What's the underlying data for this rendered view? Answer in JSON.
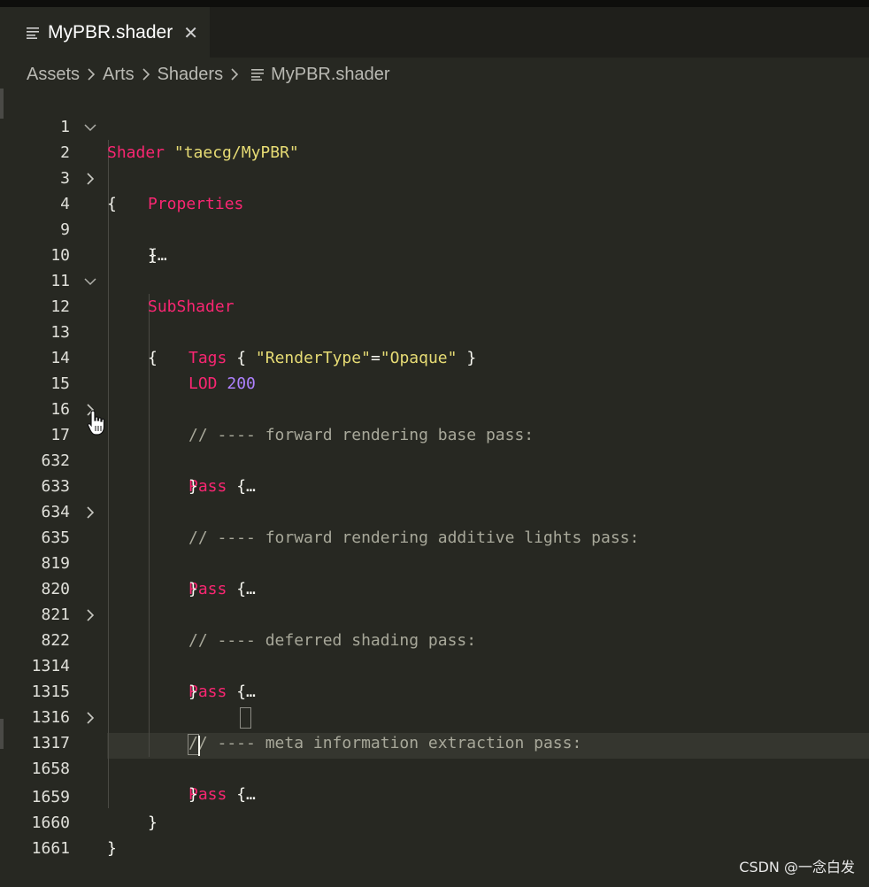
{
  "tab": {
    "title": "MyPBR.shader",
    "close_glyph": "✕"
  },
  "breadcrumb": {
    "items": [
      "Assets",
      "Arts",
      "Shaders"
    ],
    "file": "MyPBR.shader"
  },
  "editor": {
    "lines": [
      {
        "num": "1",
        "fold": ""
      },
      {
        "num": "2",
        "fold": "expanded"
      },
      {
        "num": "3",
        "fold": ""
      },
      {
        "num": "4",
        "fold": "collapsed"
      },
      {
        "num": "9",
        "fold": ""
      },
      {
        "num": "10",
        "fold": ""
      },
      {
        "num": "11",
        "fold": ""
      },
      {
        "num": "12",
        "fold": "expanded"
      },
      {
        "num": "13",
        "fold": ""
      },
      {
        "num": "14",
        "fold": ""
      },
      {
        "num": "15",
        "fold": ""
      },
      {
        "num": "16",
        "fold": ""
      },
      {
        "num": "17",
        "fold": "collapsed"
      },
      {
        "num": "632",
        "fold": ""
      },
      {
        "num": "633",
        "fold": ""
      },
      {
        "num": "634",
        "fold": ""
      },
      {
        "num": "635",
        "fold": "collapsed"
      },
      {
        "num": "819",
        "fold": ""
      },
      {
        "num": "820",
        "fold": ""
      },
      {
        "num": "821",
        "fold": ""
      },
      {
        "num": "822",
        "fold": "collapsed"
      },
      {
        "num": "1314",
        "fold": ""
      },
      {
        "num": "1315",
        "fold": ""
      },
      {
        "num": "1316",
        "fold": ""
      },
      {
        "num": "1317",
        "fold": "collapsed"
      },
      {
        "num": "1658",
        "fold": ""
      },
      {
        "num": "1659",
        "fold": ""
      },
      {
        "num": "1660",
        "fold": ""
      },
      {
        "num": "1661",
        "fold": ""
      }
    ],
    "code": {
      "shader_kw": "Shader",
      "shader_name": "\"taecg/MyPBR\"",
      "open_brace": "{",
      "close_brace": "}",
      "folded_open": "{…",
      "properties_kw": "Properties",
      "subshader_kw": "SubShader",
      "tags_kw": "Tags",
      "tags_open": "{ ",
      "tags_key": "\"RenderType\"",
      "tags_eq": "=",
      "tags_val": "\"Opaque\"",
      "tags_close": " }",
      "lod_kw": "LOD",
      "lod_val": "200",
      "pass_kw": "Pass",
      "ellipsis": "…",
      "comment_forward_base": "// ---- forward rendering base pass:",
      "comment_forward_add": "// ---- forward rendering additive lights pass:",
      "comment_deferred": "// ---- deferred shading pass:",
      "comment_meta": "// ---- meta information extraction pass:"
    }
  },
  "watermark": "CSDN @一念白发",
  "colors": {
    "background": "#272822",
    "keyword": "#f92672",
    "string": "#e6db74",
    "number": "#ae81ff",
    "comment": "#a8a89a"
  }
}
